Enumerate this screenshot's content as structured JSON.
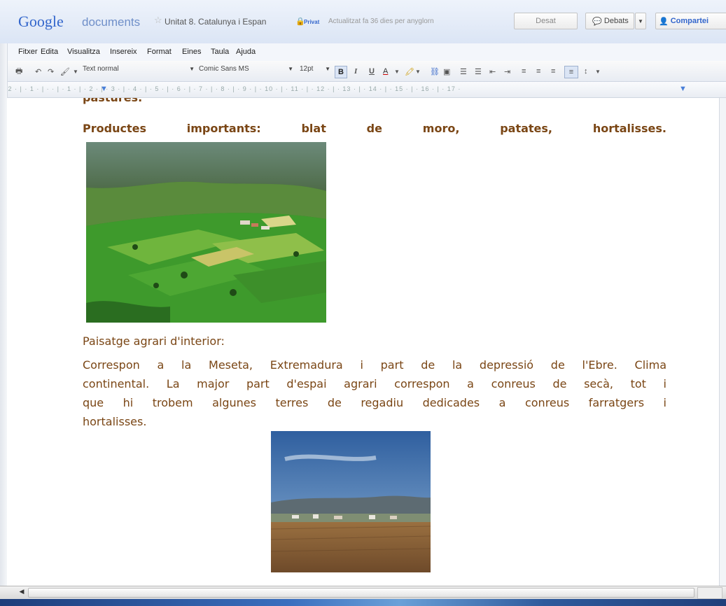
{
  "header": {
    "logo": "Google",
    "logo_sub": "documents",
    "doc_title": "Unitat 8. Catalunya i Espan",
    "private_label": "Privat",
    "save_status": "Actualitzat fa 36 dies per anyglorn",
    "save_label": "Desat",
    "share_label": "Debats",
    "share_with_label": "Compartei"
  },
  "menu": [
    "Fitxer",
    "Edita",
    "Visualitza",
    "Insereix",
    "Format",
    "Eines",
    "Taula",
    "Ajuda"
  ],
  "toolbar": {
    "style_select": "Text normal",
    "font_select": "Comic Sans MS",
    "size_select": "12pt",
    "bold": "B",
    "italic": "I",
    "underline": "U",
    "text_color": "A"
  },
  "ruler": {
    "text": "· 2 · | · 1 · | · · | · 1 · | · 2 · | · 3 · | · 4 · | · 5 · | · 6 · | · 7 · | · 8 · | · 9 · | · 10 · | · 11 · | · 12 · | · 13 · | · 14 · | · 15 · | · 16 · | · 17 ·"
  },
  "document": {
    "cut_line": "pastures.",
    "products_line": "Productes importants: blat de moro, patates, hortalisses.",
    "heading": "Paisatge agrari d'interior:",
    "body_lines": [
      "Correspon a la Meseta, Extremadura i part de la depressió de l'Ebre. Clima",
      "continental. La major part d'espai agrari correspon a conreus de secà, tot i",
      "que hi trobem algunes terres de regadiu dedicades a conreus farratgers i"
    ],
    "body_last": "hortalisses."
  },
  "colors": {
    "text": "#7a4615",
    "accent": "#3366cc"
  }
}
